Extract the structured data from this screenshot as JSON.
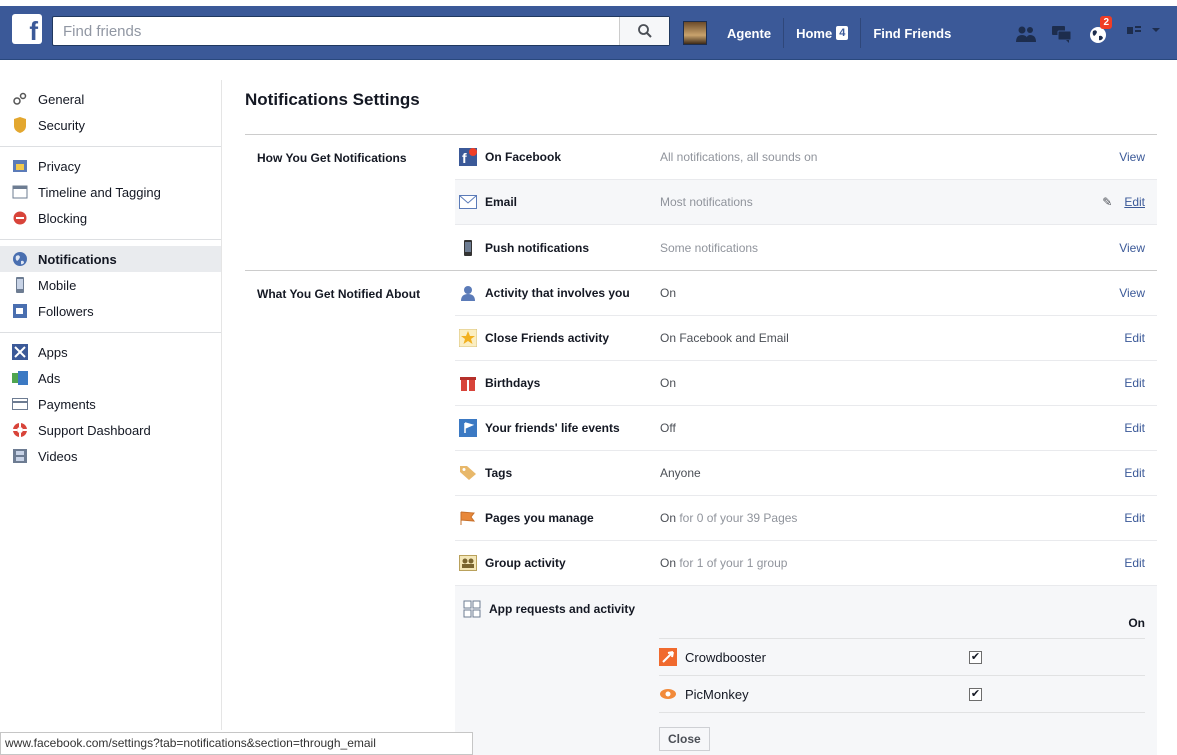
{
  "header": {
    "search_placeholder": "Find friends",
    "user_name": "Agente",
    "home_label": "Home",
    "home_count": "4",
    "find_friends_label": "Find Friends",
    "notifications_badge": "2"
  },
  "sidebar": {
    "groups": [
      [
        {
          "label": "General",
          "icon": "gears-icon"
        },
        {
          "label": "Security",
          "icon": "badge-icon"
        }
      ],
      [
        {
          "label": "Privacy",
          "icon": "lock-icon"
        },
        {
          "label": "Timeline and Tagging",
          "icon": "timeline-icon"
        },
        {
          "label": "Blocking",
          "icon": "blocking-icon"
        }
      ],
      [
        {
          "label": "Notifications",
          "icon": "globe-icon"
        },
        {
          "label": "Mobile",
          "icon": "mobile-icon"
        },
        {
          "label": "Followers",
          "icon": "followers-icon"
        }
      ],
      [
        {
          "label": "Apps",
          "icon": "apps-icon"
        },
        {
          "label": "Ads",
          "icon": "ads-icon"
        },
        {
          "label": "Payments",
          "icon": "credit-card-icon"
        },
        {
          "label": "Support Dashboard",
          "icon": "lifebuoy-icon"
        },
        {
          "label": "Videos",
          "icon": "film-icon"
        }
      ]
    ]
  },
  "main": {
    "title": "Notifications Settings",
    "how_section": {
      "label": "How You Get Notifications",
      "rows": [
        {
          "name": "On Facebook",
          "value": "All notifications, all sounds on",
          "action": "View"
        },
        {
          "name": "Email",
          "value": "Most notifications",
          "action": "Edit"
        },
        {
          "name": "Push notifications",
          "value": "Some notifications",
          "action": "View"
        }
      ]
    },
    "what_section": {
      "label": "What You Get Notified About",
      "rows": [
        {
          "name": "Activity that involves you",
          "value_strong": "On",
          "value_rest": "",
          "action": "View"
        },
        {
          "name": "Close Friends activity",
          "value_strong": "On Facebook and Email",
          "value_rest": "",
          "action": "Edit"
        },
        {
          "name": "Birthdays",
          "value_strong": "On",
          "value_rest": "",
          "action": "Edit"
        },
        {
          "name": "Your friends' life events",
          "value_strong": "Off",
          "value_rest": "",
          "action": "Edit"
        },
        {
          "name": "Tags",
          "value_strong": "Anyone",
          "value_rest": "",
          "action": "Edit"
        },
        {
          "name": "Pages you manage",
          "value_strong": "On",
          "value_rest": " for 0 of your 39 Pages",
          "action": "Edit"
        },
        {
          "name": "Group activity",
          "value_strong": "On",
          "value_rest": " for 1 of your 1 group",
          "action": "Edit"
        }
      ],
      "app_requests": {
        "name": "App requests and activity",
        "state": "On",
        "apps": [
          {
            "name": "Crowdbooster",
            "checked": true
          },
          {
            "name": "PicMonkey",
            "checked": true
          }
        ],
        "close_label": "Close"
      }
    }
  },
  "status_bar": "www.facebook.com/settings?tab=notifications&section=through_email",
  "colors": {
    "brand": "#3b5998",
    "link": "#3b5998",
    "muted": "#90949c"
  }
}
